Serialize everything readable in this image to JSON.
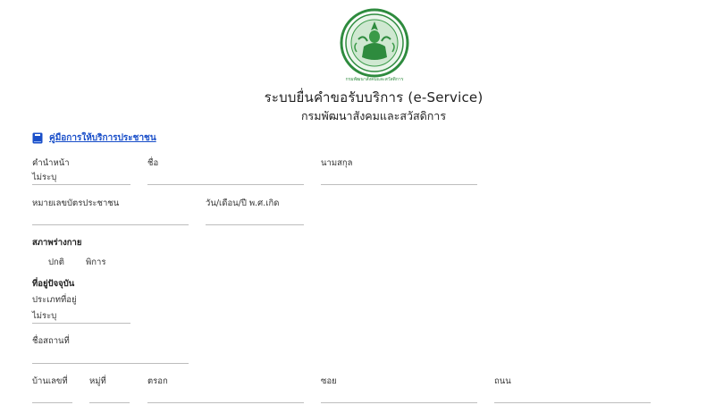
{
  "header": {
    "logo_caption": "กรมพัฒนาสังคมและสวัสดิการ",
    "title": "ระบบยื่นคำขอรับบริการ (e-Service)",
    "subtitle": "กรมพัฒนาสังคมและสวัสดิการ"
  },
  "manual_link": {
    "label": "คู่มือการให้บริการประชาชน",
    "icon": "book-icon",
    "color": "#1a4fc9"
  },
  "form": {
    "prefix": {
      "label": "คำนำหน้า",
      "value": "ไม่ระบุ"
    },
    "first_name": {
      "label": "ชื่อ",
      "value": ""
    },
    "last_name": {
      "label": "นามสกุล",
      "value": ""
    },
    "citizen_id": {
      "label": "หมายเลขบัตรประชาชน",
      "value": ""
    },
    "birth_date": {
      "label": "วัน/เดือน/ปี พ.ศ.เกิด",
      "value": ""
    },
    "physical_section": "สภาพร่างกาย",
    "physical_options": [
      "ปกติ",
      "พิการ"
    ],
    "address_section": "ที่อยู่ปัจจุบัน",
    "residence_type": {
      "label": "ประเภทที่อยู่",
      "value": "ไม่ระบุ"
    },
    "place_name": {
      "label": "ชื่อสถานที่",
      "value": ""
    },
    "house_no": {
      "label": "บ้านเลขที่",
      "value": ""
    },
    "moo": {
      "label": "หมู่ที่",
      "value": ""
    },
    "alley": {
      "label": "ตรอก",
      "value": ""
    },
    "soi": {
      "label": "ซอย",
      "value": ""
    },
    "road": {
      "label": "ถนน",
      "value": ""
    }
  },
  "colors": {
    "line": "#bdbdbd",
    "seal_green": "#2e8b3e"
  }
}
